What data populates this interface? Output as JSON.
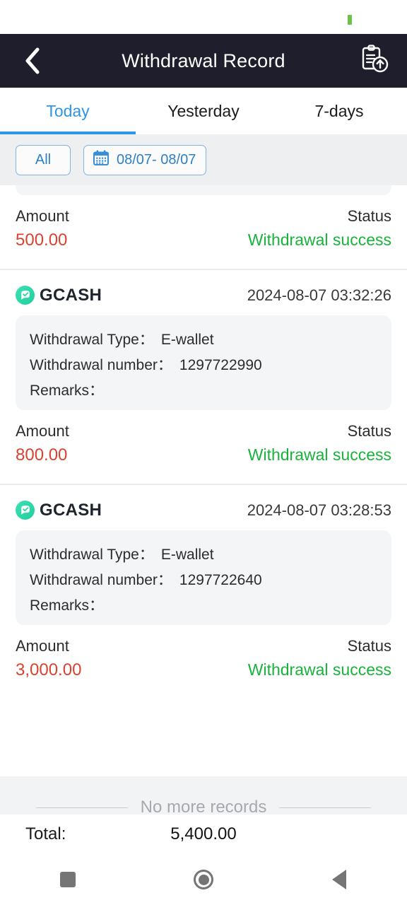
{
  "statusbar": {
    "indicator_icon": "green-bar-icon"
  },
  "header": {
    "back_icon": "chevron-left-icon",
    "title": "Withdrawal Record",
    "action_icon": "clipboard-upload-icon",
    "background_color": "#1e1e2c"
  },
  "tabs": {
    "items": [
      {
        "label": "Today",
        "active": true
      },
      {
        "label": "Yesterday",
        "active": false
      },
      {
        "label": "7-days",
        "active": false
      }
    ],
    "accent_color": "#2f95e6"
  },
  "filters": {
    "all_label": "All",
    "calendar_icon": "calendar-icon",
    "date_range": "08/07- 08/07"
  },
  "labels": {
    "amount_caption": "Amount",
    "status_caption": "Status",
    "withdrawal_type": "Withdrawal Type：",
    "withdrawal_number": "Withdrawal number：",
    "remarks": "Remarks："
  },
  "records": [
    {
      "clipped": true,
      "amount": "500.00",
      "status": "Withdrawal success"
    },
    {
      "clipped": false,
      "brand": "GCASH",
      "brand_icon": "gcash-logo-icon",
      "timestamp": "2024-08-07 03:32:26",
      "withdrawal_type": "E-wallet",
      "withdrawal_number": "1297722990",
      "remarks": "",
      "amount": "800.00",
      "status": "Withdrawal success"
    },
    {
      "clipped": false,
      "brand": "GCASH",
      "brand_icon": "gcash-logo-icon",
      "timestamp": "2024-08-07 03:28:53",
      "withdrawal_type": "E-wallet",
      "withdrawal_number": "1297722640",
      "remarks": "",
      "amount": "3,000.00",
      "status": "Withdrawal success"
    }
  ],
  "footer": {
    "no_more_records": "No more records",
    "total_label": "Total:",
    "total_value": "5,400.00"
  },
  "navbar": {
    "recents_icon": "square-icon",
    "home_icon": "circle-icon",
    "back_icon": "triangle-back-icon"
  },
  "colors": {
    "amount": "#d9432f",
    "status_success": "#18b33a",
    "accent_blue": "#2f95e6",
    "appbar": "#1e1e2c"
  }
}
